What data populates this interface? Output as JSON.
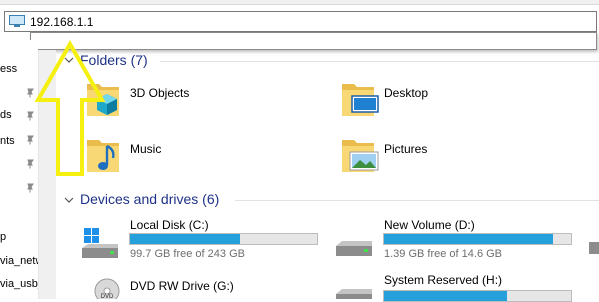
{
  "address_bar": {
    "value": "192.168.1.1"
  },
  "nav": {
    "items": [
      {
        "label": "ess"
      },
      {
        "label": "ds"
      },
      {
        "label": "nts"
      },
      {
        "label": "p"
      },
      {
        "label": "via_netw"
      },
      {
        "label": "via_usb_"
      }
    ]
  },
  "folders": {
    "header": "Folders (7)",
    "items": [
      {
        "label": "3D Objects",
        "icon": "3d-objects-icon"
      },
      {
        "label": "Desktop",
        "icon": "desktop-folder-icon"
      },
      {
        "label": "Music",
        "icon": "music-folder-icon"
      },
      {
        "label": "Pictures",
        "icon": "pictures-folder-icon"
      }
    ]
  },
  "devices": {
    "header": "Devices and drives (6)",
    "drives": [
      {
        "name": "Local Disk (C:)",
        "free": "99.7 GB free of 243 GB",
        "used_fraction": 0.59,
        "icon": "windows-drive-icon"
      },
      {
        "name": "New Volume (D:)",
        "free": "1.39 GB free of 14.6 GB",
        "used_fraction": 0.905,
        "icon": "hard-drive-icon"
      },
      {
        "name": "DVD RW Drive (G:)",
        "icon": "dvd-drive-icon"
      },
      {
        "name": "System Reserved (H:)",
        "used_fraction": 0.66,
        "icon": "hard-drive-icon"
      }
    ]
  },
  "annotation": {
    "arrow_color": "#f5f00f"
  },
  "colors": {
    "header": "#1e3287",
    "bar_fill": "#26a0da",
    "folder": "#f8d775"
  }
}
